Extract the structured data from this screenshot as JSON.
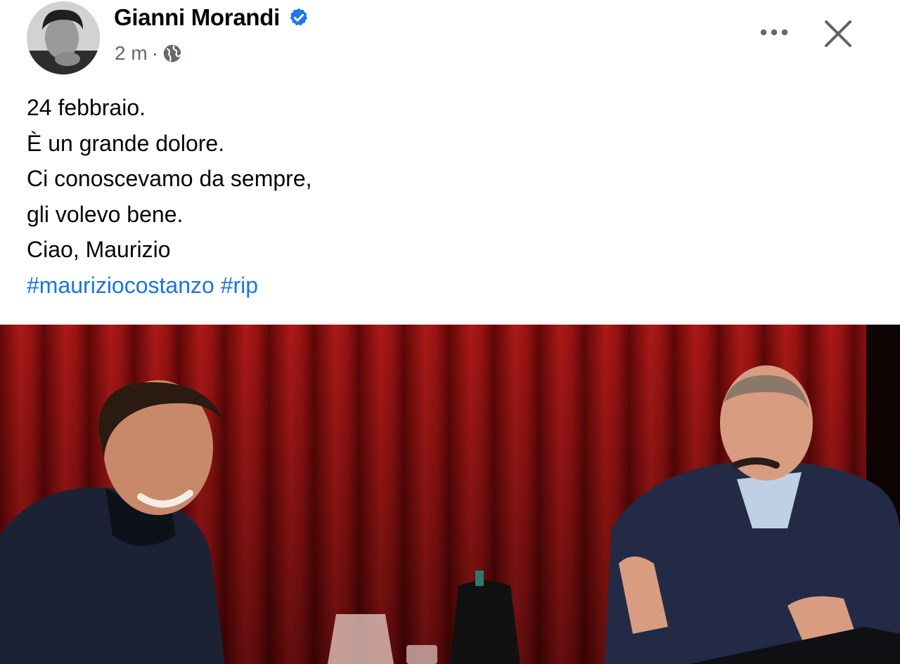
{
  "post": {
    "author": "Gianni Morandi",
    "time": "2 m",
    "separator": "·",
    "lines": [
      "24 febbraio.",
      "È un grande dolore.",
      "Ci conoscevamo da sempre,",
      "gli volevo bene.",
      "Ciao, Maurizio"
    ],
    "hashtags": [
      "#mauriziocostanzo",
      "#rip"
    ]
  },
  "icons": {
    "verified": "verified-badge-icon",
    "audience": "globe-icon",
    "more": "more-dots-icon",
    "close": "close-icon"
  },
  "colors": {
    "link": "#1b74e4",
    "verified": "#1877f2",
    "secondary_text": "#65676b",
    "curtain": "#9b1414"
  }
}
